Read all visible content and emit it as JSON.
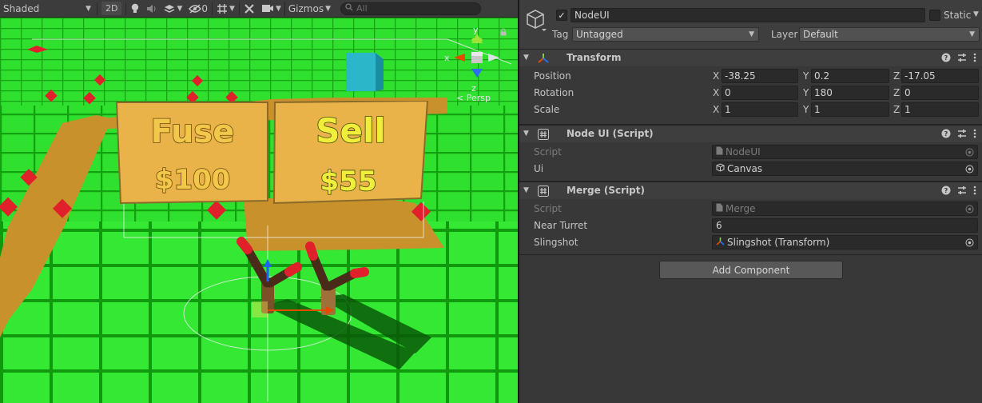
{
  "scene": {
    "shading_mode": "Shaded",
    "toggle_2d": "2D",
    "hidden_count": "0",
    "gizmos": "Gizmos",
    "search_placeholder": "All",
    "axes": {
      "y": "y",
      "x": "x",
      "z": "z"
    },
    "persp_label": "< Persp",
    "signs": [
      {
        "title": "Fuse",
        "price": "$100"
      },
      {
        "title": "Sell",
        "price": "$55"
      }
    ],
    "colors": {
      "ground": "#2fe02f",
      "path": "#c8912c",
      "sign_bg": "#e9b34a",
      "gem": "#e0202a",
      "cube": "#2bb7c9"
    }
  },
  "inspector": {
    "object_name": "NodeUI",
    "active": true,
    "static_label": "Static",
    "static_checked": false,
    "tag_label": "Tag",
    "tag_value": "Untagged",
    "layer_label": "Layer",
    "layer_value": "Default",
    "components": [
      {
        "title": "Transform",
        "rows": [
          {
            "label": "Position",
            "x": "-38.25",
            "y": "0.2",
            "z": "-17.05"
          },
          {
            "label": "Rotation",
            "x": "0",
            "y": "180",
            "z": "0"
          },
          {
            "label": "Scale",
            "x": "1",
            "y": "1",
            "z": "1"
          }
        ]
      },
      {
        "title": "Node UI (Script)",
        "script_label": "Script",
        "script_value": "NodeUI",
        "ui_label": "Ui",
        "ui_value": "Canvas"
      },
      {
        "title": "Merge (Script)",
        "script_label": "Script",
        "script_value": "Merge",
        "near_label": "Near Turret",
        "near_value": "6",
        "slingshot_label": "Slingshot",
        "slingshot_value": "Slingshot (Transform)"
      }
    ],
    "xyz_labels": {
      "x": "X",
      "y": "Y",
      "z": "Z"
    },
    "add_component": "Add Component"
  }
}
